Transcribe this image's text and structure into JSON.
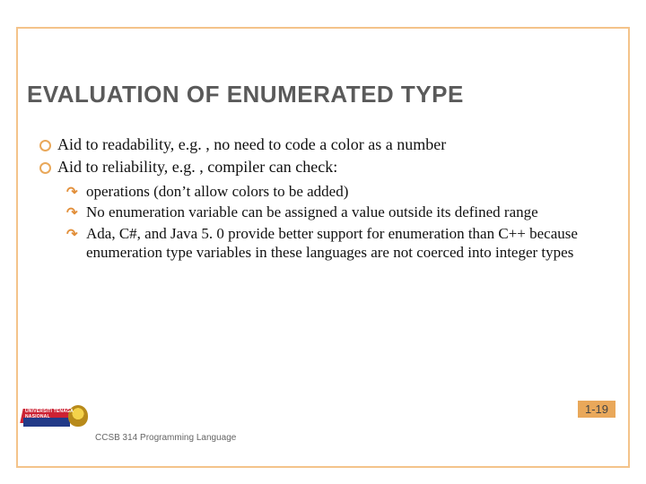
{
  "title": "EVALUATION OF ENUMERATED TYPE",
  "bullets": {
    "b1": "Aid to readability, e.g. , no need to code a color as a number",
    "b2": "Aid to reliability, e.g. , compiler can check:"
  },
  "subbullets": {
    "s1": "operations (don’t allow colors to be added)",
    "s2": "No enumeration variable can be assigned a value outside its defined range",
    "s3": "Ada, C#, and Java 5. 0 provide better support for enumeration than C++ because enumeration type variables in these languages are not coerced into integer types"
  },
  "page_number": "1-19",
  "footer": "CCSB 314 Programming Language",
  "logo_label": "UNIVERSITI TENAGA NASIONAL"
}
